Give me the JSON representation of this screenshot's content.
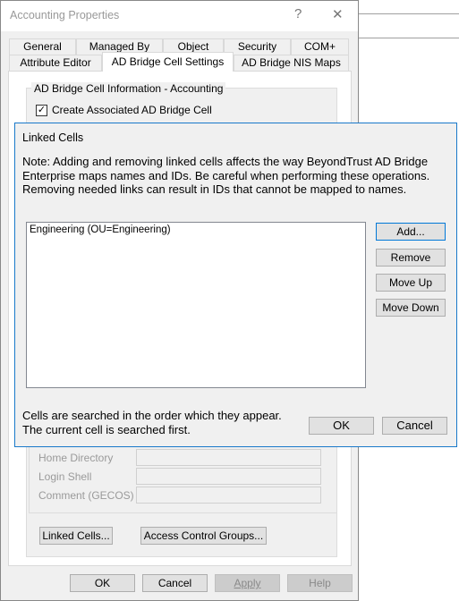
{
  "window": {
    "title": "Accounting Properties",
    "help_glyph": "?",
    "close_glyph": "✕"
  },
  "tabs_row1": [
    "General",
    "Managed By",
    "Object",
    "Security",
    "COM+"
  ],
  "tabs_row2": [
    "Attribute Editor",
    "AD Bridge Cell Settings",
    "AD Bridge NIS Maps"
  ],
  "selected_tab": "AD Bridge Cell Settings",
  "group": {
    "title": "AD Bridge Cell Information - Accounting",
    "checkbox_label": "Create Associated AD Bridge Cell",
    "checkbox_checked": true,
    "check_glyph": "✓"
  },
  "fields": [
    {
      "label": "Home Directory",
      "value": ""
    },
    {
      "label": "Login Shell",
      "value": ""
    },
    {
      "label": "Comment (GECOS)",
      "value": ""
    }
  ],
  "panel_buttons": {
    "linked_cells": "Linked Cells...",
    "access_control": "Access Control Groups..."
  },
  "dialog_buttons": {
    "ok": "OK",
    "cancel": "Cancel",
    "apply": "Apply",
    "help": "Help"
  },
  "linked_cells": {
    "title": "Linked Cells",
    "note": "Note: Adding and removing linked cells affects the way BeyondTrust AD Bridge Enterprise maps names and IDs. Be careful when performing these operations. Removing needed links can result in IDs that cannot be mapped to names.",
    "items": [
      "Engineering (OU=Engineering)"
    ],
    "buttons": {
      "add": "Add...",
      "remove": "Remove",
      "move_up": "Move Up",
      "move_down": "Move Down",
      "ok": "OK",
      "cancel": "Cancel"
    },
    "footer_line1": "Cells are searched in the order which they appear.",
    "footer_line2": "The current cell is searched first.",
    "accent": "#1979ca"
  }
}
